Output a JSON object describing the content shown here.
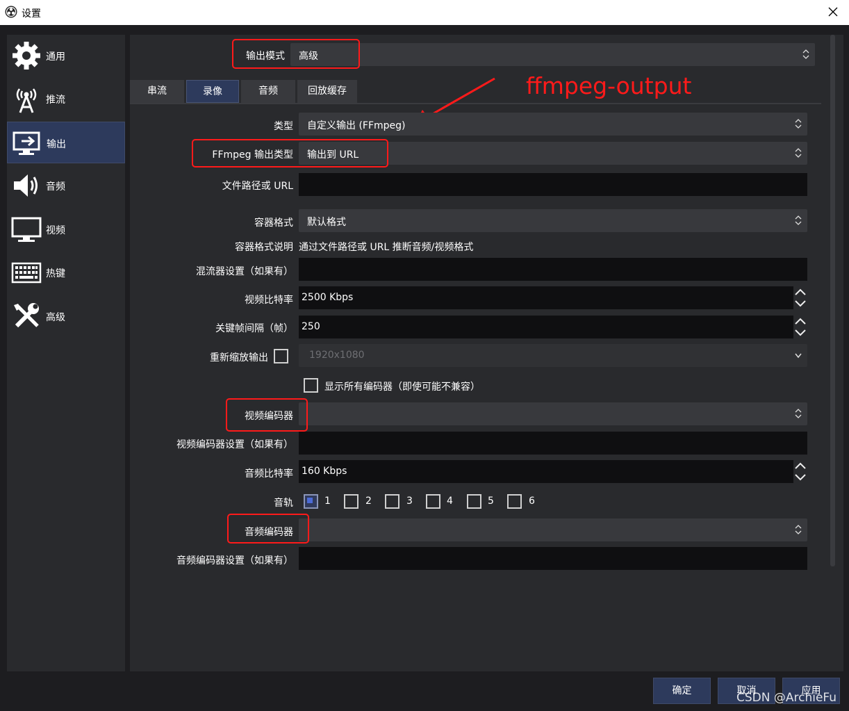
{
  "window": {
    "title": "设置"
  },
  "sidebar": {
    "items": [
      {
        "label": "通用",
        "icon": "gear-icon"
      },
      {
        "label": "推流",
        "icon": "broadcast-antenna-icon"
      },
      {
        "label": "输出",
        "icon": "monitor-output-icon",
        "active": true
      },
      {
        "label": "音频",
        "icon": "speaker-icon"
      },
      {
        "label": "视频",
        "icon": "monitor-icon"
      },
      {
        "label": "热键",
        "icon": "keyboard-icon"
      },
      {
        "label": "高级",
        "icon": "tools-icon"
      }
    ]
  },
  "output_mode": {
    "label": "输出模式",
    "value": "高级"
  },
  "tabs": [
    {
      "label": "串流"
    },
    {
      "label": "录像",
      "active": true
    },
    {
      "label": "音频"
    },
    {
      "label": "回放缓存"
    }
  ],
  "annotation": {
    "text": "ffmpeg-output",
    "color": "#ff1a1a"
  },
  "form": {
    "type": {
      "label": "类型",
      "value": "自定义输出 (FFmpeg)"
    },
    "ffmpeg_output_type": {
      "label": "FFmpeg 输出类型",
      "value": "输出到 URL"
    },
    "file_path": {
      "label": "文件路径或 URL",
      "value": ""
    },
    "container_format": {
      "label": "容器格式",
      "value": "默认格式"
    },
    "container_desc": {
      "label": "容器格式说明",
      "value": "通过文件路径或 URL 推断音频/视频格式"
    },
    "muxer_settings": {
      "label": "混流器设置（如果有）",
      "value": ""
    },
    "video_bitrate": {
      "label": "视频比特率",
      "value": "2500 Kbps"
    },
    "keyframe_interval": {
      "label": "关键帧间隔（帧）",
      "value": "250"
    },
    "rescale_output": {
      "label": "重新缩放输出",
      "checked": false,
      "value": "1920x1080"
    },
    "show_all_encoders": {
      "label": "显示所有编码器（即使可能不兼容）",
      "checked": false
    },
    "video_encoder": {
      "label": "视频编码器",
      "value": ""
    },
    "video_encoder_settings": {
      "label": "视频编码器设置（如果有）",
      "value": ""
    },
    "audio_bitrate": {
      "label": "音频比特率",
      "value": "160 Kbps"
    },
    "audio_track": {
      "label": "音轨",
      "tracks": [
        {
          "n": "1",
          "checked": true
        },
        {
          "n": "2",
          "checked": false
        },
        {
          "n": "3",
          "checked": false
        },
        {
          "n": "4",
          "checked": false
        },
        {
          "n": "5",
          "checked": false
        },
        {
          "n": "6",
          "checked": false
        }
      ]
    },
    "audio_encoder": {
      "label": "音频编码器",
      "value": ""
    },
    "audio_encoder_settings": {
      "label": "音频编码器设置（如果有）",
      "value": ""
    }
  },
  "footer": {
    "ok": "确定",
    "cancel": "取消",
    "apply": "应用"
  },
  "watermark": "CSDN @ArchieFu"
}
